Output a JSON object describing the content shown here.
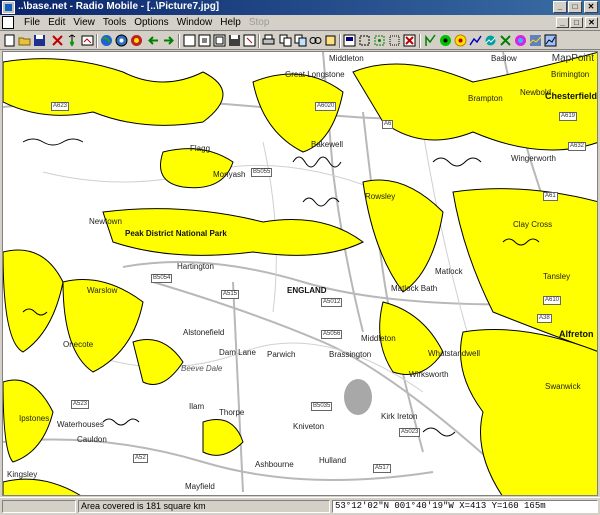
{
  "window": {
    "title": "..\\base.net - Radio Mobile - [..\\Picture7.jpg]",
    "buttons": {
      "minimize": "_",
      "maximize": "□",
      "close": "✕"
    }
  },
  "menubar": {
    "items": [
      "File",
      "Edit",
      "View",
      "Tools",
      "Options",
      "Window",
      "Help",
      "Stop"
    ]
  },
  "toolbar": {
    "icons": [
      "new-icon",
      "open-icon",
      "save-icon",
      "properties-icon",
      "unit-properties-icon",
      "open-map-icon",
      "world-icon",
      "map-properties-icon",
      "nav-back-icon",
      "nav-forward-icon",
      "picture-icon",
      "copy-icon",
      "paste-icon",
      "print-icon",
      "merge-icon",
      "extract-icon",
      "cities-icon",
      "zoom-icon",
      "grid-icon",
      "select-icon",
      "cancel-icon",
      "radio-link-icon",
      "polar-plot-icon",
      "coverage-icon",
      "route-icon",
      "terrain-icon",
      "settings-icon",
      "elevation-icon"
    ]
  },
  "map": {
    "watermark": "MapPoint",
    "places": [
      "Middleton",
      "Great Longstone",
      "Baslow",
      "Brampton",
      "Newbold",
      "Chesterfield",
      "Brimington",
      "Flagg",
      "Bakewell",
      "Wingerworth",
      "Monyash",
      "Rowsley",
      "Clay Cross",
      "Newtown",
      "Peak District National Park",
      "Hartington",
      "Matlock",
      "Tansley",
      "Warslow",
      "ENGLAND",
      "Matlock Bath",
      "Alstonefield",
      "Middleton",
      "Dam Lane",
      "Parwich",
      "Brassington",
      "Wirksworth",
      "Whatstandwell",
      "Alfreton",
      "Onecote",
      "Beeve Dale",
      "Ilam",
      "Thorpe",
      "Ipstones",
      "Waterhouses",
      "Kniveton",
      "Kirk Ireton",
      "Cauldon",
      "Ashbourne",
      "Hulland",
      "Mayfield",
      "Kingsley",
      "Swanwick"
    ],
    "roads": [
      "A623",
      "A6",
      "A619",
      "A632",
      "A61",
      "B5055",
      "A6020",
      "B5054",
      "A515",
      "A5012",
      "A5056",
      "B5035",
      "A523",
      "A52",
      "A517",
      "A5023",
      "A610",
      "A38"
    ]
  },
  "statusbar": {
    "area": "Area covered is 181 square km",
    "coords": "53°12'02\"N 001°40'19\"W X=413 Y=160 165m"
  },
  "colors": {
    "coverage": "#ffff00",
    "titlebar_start": "#0a246a",
    "chrome": "#d4d0c8"
  }
}
